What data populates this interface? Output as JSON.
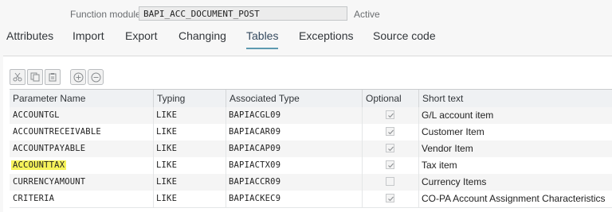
{
  "function_module": {
    "label": "Function module:",
    "value": "BAPI_ACC_DOCUMENT_POST",
    "status": "Active"
  },
  "tabs": [
    {
      "label": "Attributes",
      "active": false
    },
    {
      "label": "Import",
      "active": false
    },
    {
      "label": "Export",
      "active": false
    },
    {
      "label": "Changing",
      "active": false
    },
    {
      "label": "Tables",
      "active": true
    },
    {
      "label": "Exceptions",
      "active": false
    },
    {
      "label": "Source code",
      "active": false
    }
  ],
  "toolbar": {
    "buttons": [
      "cut-icon",
      "copy-icon",
      "paste-icon",
      "add-row-icon",
      "remove-row-icon"
    ]
  },
  "table": {
    "columns": [
      "Parameter Name",
      "Typing",
      "Associated Type",
      "Optional",
      "Short text"
    ],
    "rows": [
      {
        "name": "ACCOUNTGL",
        "typing": "LIKE",
        "type": "BAPIACGL09",
        "optional": true,
        "text": "G/L account item",
        "highlight": false
      },
      {
        "name": "ACCOUNTRECEIVABLE",
        "typing": "LIKE",
        "type": "BAPIACAR09",
        "optional": true,
        "text": "Customer Item",
        "highlight": false
      },
      {
        "name": "ACCOUNTPAYABLE",
        "typing": "LIKE",
        "type": "BAPIACAP09",
        "optional": true,
        "text": "Vendor Item",
        "highlight": false
      },
      {
        "name": "ACCOUNTTAX",
        "typing": "LIKE",
        "type": "BAPIACTX09",
        "optional": true,
        "text": "Tax item",
        "highlight": true
      },
      {
        "name": "CURRENCYAMOUNT",
        "typing": "LIKE",
        "type": "BAPIACCR09",
        "optional": false,
        "text": "Currency Items",
        "highlight": false
      },
      {
        "name": "CRITERIA",
        "typing": "LIKE",
        "type": "BAPIACKEC9",
        "optional": true,
        "text": "CO-PA Account Assignment Characteristics",
        "highlight": false
      }
    ]
  },
  "colors": {
    "highlight": "#f7f35a",
    "active_tab_underline": "#5e9ab0"
  }
}
